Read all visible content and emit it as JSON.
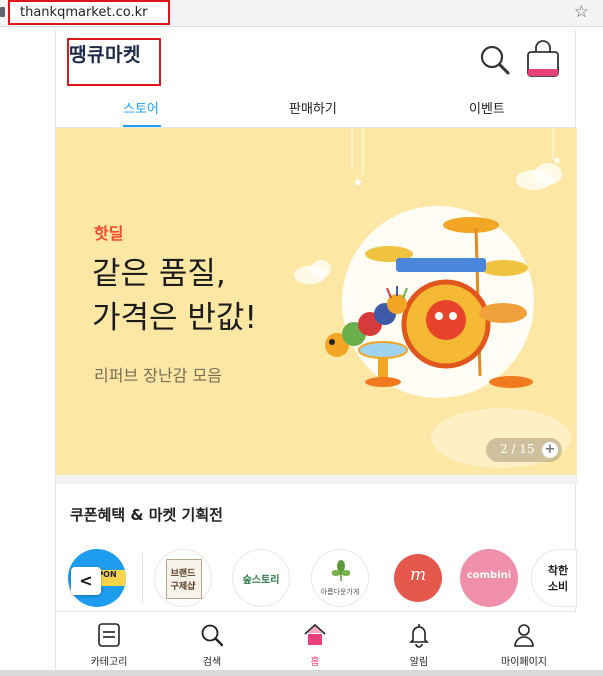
{
  "browser": {
    "url": "thankqmarket.co.kr",
    "star_icon": "star-icon"
  },
  "header": {
    "logo": "땡큐마켓",
    "search_icon": "search-icon",
    "cart_icon": "shopping-bag-icon"
  },
  "tabs": [
    {
      "label": "스토어",
      "active": true
    },
    {
      "label": "판매하기",
      "active": false
    },
    {
      "label": "이벤트",
      "active": false
    }
  ],
  "banner": {
    "tag": "핫딜",
    "headline_line1": "같은 품질,",
    "headline_line2": "가격은 반값!",
    "subline": "리퍼브 장난감 모음",
    "pager": "2 / 15",
    "pager_plus": "+",
    "background": "#fde7a5"
  },
  "section": {
    "title": "쿠폰혜택 & 마켓 기획전",
    "prev_label": "<",
    "items": [
      {
        "name": "coupon",
        "label": "PON"
      },
      {
        "name": "brand-refurb",
        "label_line1": "브랜드",
        "label_line2": "구제샵"
      },
      {
        "name": "soop-story",
        "label": "숲스토리"
      },
      {
        "name": "beautiful-store",
        "label": "아름다운가게"
      },
      {
        "name": "m-brand",
        "label": "m"
      },
      {
        "name": "combini",
        "label": "combini"
      },
      {
        "name": "good-consumption",
        "label_line1": "착한",
        "label_line2": "소비"
      }
    ]
  },
  "bottom_nav": [
    {
      "label": "카테고리",
      "icon": "category-icon",
      "active": false
    },
    {
      "label": "검색",
      "icon": "search-icon",
      "active": false
    },
    {
      "label": "홈",
      "icon": "home-icon",
      "active": true
    },
    {
      "label": "알림",
      "icon": "bell-icon",
      "active": false
    },
    {
      "label": "마이페이지",
      "icon": "user-icon",
      "active": false
    }
  ],
  "colors": {
    "accent": "#1ea0f0",
    "home_active": "#e83e7a",
    "highlight_box": "#e0151a",
    "hot_deal": "#f04c2b"
  }
}
